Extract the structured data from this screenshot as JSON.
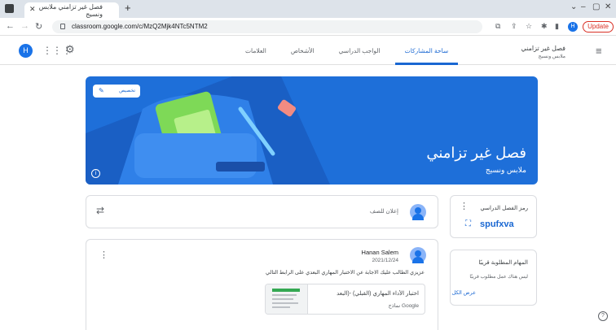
{
  "browser": {
    "tab_title": "فصل غير تزامني ملابس ونسيج",
    "url": "classroom.google.com/c/MzQ2Mjk4NTc5NTM2",
    "update_label": "Update",
    "profile_initial": "H"
  },
  "appbar": {
    "user_initial": "H",
    "class_name": "فصل غير تزامني",
    "class_section": "ملابس ونسيج",
    "tabs": [
      "ساحة المشاركات",
      "الواجب الدراسي",
      "الأشخاص",
      "العلامات"
    ]
  },
  "banner": {
    "customize_label": "تخصيص",
    "title": "فصل غير تزامني",
    "subtitle": "ملابس ونسيج",
    "accent_color": "#1e6fd9"
  },
  "sidebar": {
    "class_code_label": "رمز الفصل الدراسي",
    "class_code": "spufxva",
    "upcoming_title": "المهام المطلوبة قريبًا",
    "upcoming_text": "ليس هناك عمل مطلوب قريبًا",
    "view_all": "عرض الكل"
  },
  "stream": {
    "announce_placeholder": "إعلان للصف",
    "post": {
      "author": "Hanan Salem",
      "date": "2021/12/24",
      "text": "عزيزي الطالب عليك الاجابة عن الاختبار المهاري البعدي على الرابط التالي",
      "attachment_title": "اختبار الأداء المهاري (القبلي) -(البعد",
      "attachment_type": "نماذج Google"
    }
  }
}
